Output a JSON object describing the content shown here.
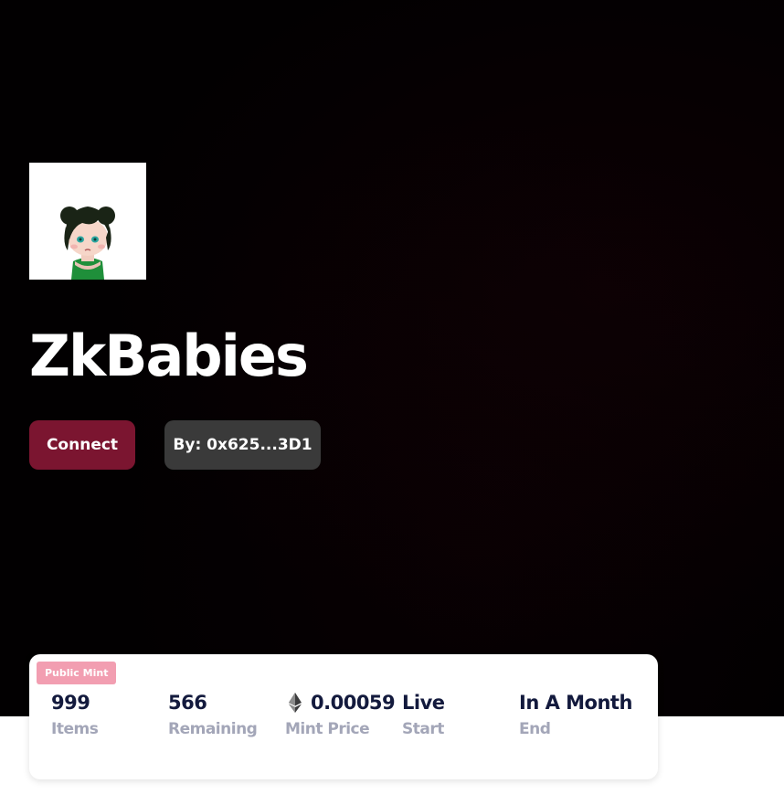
{
  "collection": {
    "name": "ZkBabies",
    "avatar_icon": "baby-avatar-icon"
  },
  "actions": {
    "connect_label": "Connect",
    "owner_label": "By: 0x625...3D1"
  },
  "mint": {
    "badge": "Public Mint",
    "stats": [
      {
        "value": "999",
        "label": "Items"
      },
      {
        "value": "566",
        "label": "Remaining"
      },
      {
        "value": "0.00059",
        "label": "Mint Price",
        "icon": "ethereum-icon"
      },
      {
        "value": "Live",
        "label": "Start"
      },
      {
        "value": "In A Month",
        "label": "End"
      }
    ]
  },
  "colors": {
    "hero_background": "#020001",
    "connect_button": "#7b1530",
    "owner_button": "#3a3a3a",
    "badge": "#f29eb1",
    "stat_value": "#131a3d",
    "stat_label": "#a3a6b8"
  }
}
